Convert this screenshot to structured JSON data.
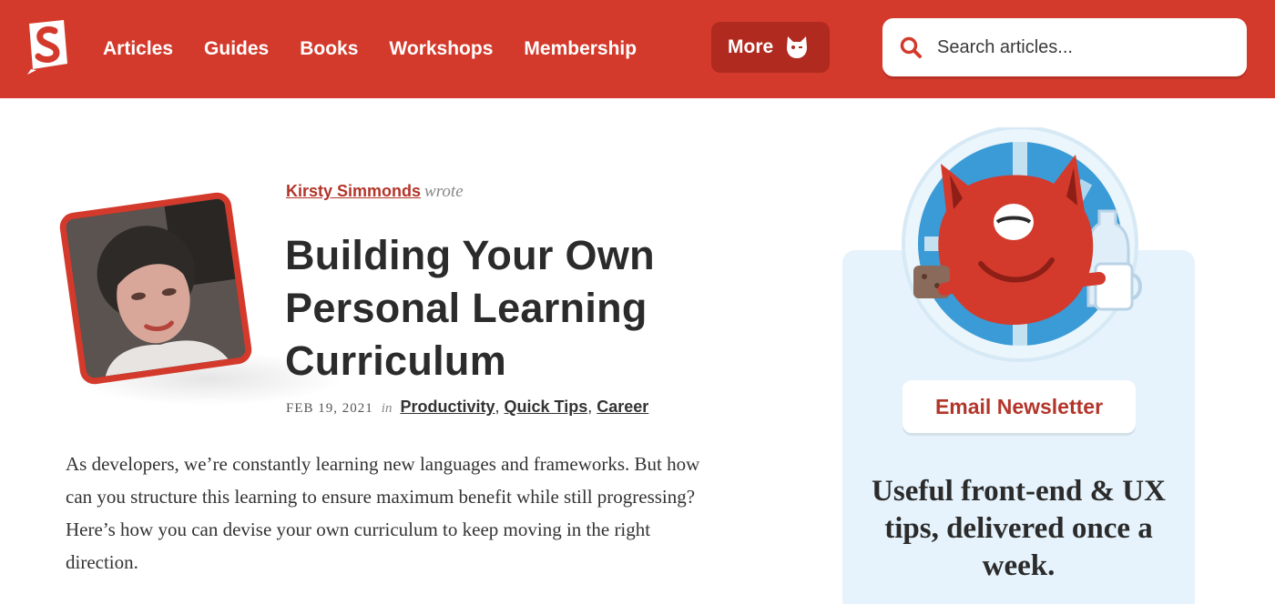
{
  "nav": {
    "items": [
      {
        "label": "Articles"
      },
      {
        "label": "Guides"
      },
      {
        "label": "Books"
      },
      {
        "label": "Workshops"
      },
      {
        "label": "Membership"
      }
    ],
    "more_label": "More",
    "search_placeholder": "Search articles..."
  },
  "article": {
    "author": "Kirsty Simmonds",
    "wrote": "wrote",
    "title": "Building Your Own Personal Learning Curriculum",
    "date": "FEB 19, 2021",
    "in": "in",
    "categories": [
      "Productivity",
      "Quick Tips",
      "Career"
    ],
    "excerpt": "As developers, we’re constantly learning new languages and frameworks. But how can you structure this learning to ensure maximum benefit while still progressing? Here’s how you can devise your own curriculum to keep moving in the right direction."
  },
  "newsletter": {
    "button_label": "Email Newsletter",
    "tagline": "Useful front-end & UX tips, delivered once a week."
  },
  "colors": {
    "brand": "#d33a2c",
    "panel": "#e6f3fc"
  }
}
